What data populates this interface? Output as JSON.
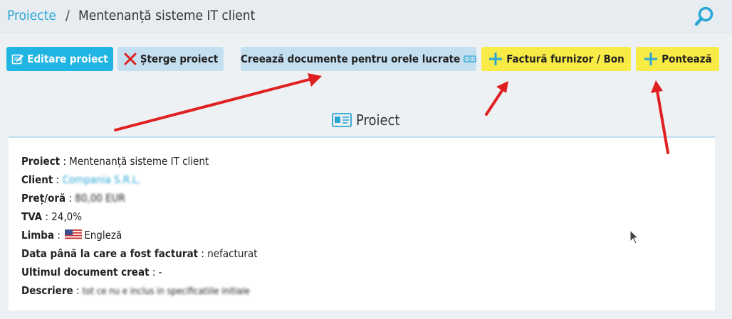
{
  "breadcrumb": {
    "link": "Proiecte",
    "separator": "/",
    "current": "Mentenanță sisteme IT client"
  },
  "toolbar": {
    "edit_label": "Editare proiect",
    "delete_label": "Șterge proiect",
    "docs_label": "Creează documente pentru orele lucrate",
    "invoice_label": "Factură furnizor / Bon",
    "clock_label": "Pontează"
  },
  "panel": {
    "title": "Proiect",
    "fields": {
      "project_label": "Proiect",
      "project_value": "Mentenanță sisteme IT client",
      "client_label": "Client",
      "client_value": "Compania S.R.L.",
      "rate_label": "Preț/oră",
      "rate_value": "80,00 EUR",
      "vat_label": "TVA",
      "vat_value": "24,0%",
      "language_label": "Limba",
      "language_value": "Engleză",
      "billed_label": "Data până la care a fost facturat",
      "billed_value": "nefacturat",
      "last_doc_label": "Ultimul document creat",
      "last_doc_value": "-",
      "description_label": "Descriere",
      "description_value": "tot ce nu e inclus in specificatiile initiale"
    }
  },
  "colors": {
    "primary": "#20b4e2",
    "light_blue": "#c4dff0",
    "yellow": "#f9eb45",
    "arrow": "#e02020"
  }
}
